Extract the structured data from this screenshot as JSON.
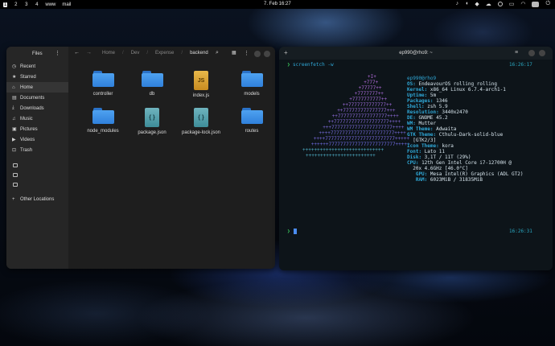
{
  "topbar": {
    "workspaces": [
      "1",
      "2",
      "3",
      "4",
      "www",
      "mail"
    ],
    "active_workspace": "1",
    "clock": "7. Feb  16:27",
    "tray_icons": [
      "bell-icon",
      "speaker-icon",
      "bird-icon",
      "cloud-icon",
      "clipboard-icon",
      "display-icon",
      "wifi-icon",
      "battery-icon",
      "power-icon"
    ]
  },
  "files": {
    "title": "Files",
    "sidebar": [
      {
        "icon": "clock-icon",
        "glyph": "◷",
        "label": "Recent"
      },
      {
        "icon": "star-icon",
        "glyph": "★",
        "label": "Starred"
      },
      {
        "icon": "home-icon",
        "glyph": "⌂",
        "label": "Home"
      },
      {
        "icon": "document-icon",
        "glyph": "▤",
        "label": "Documents"
      },
      {
        "icon": "download-icon",
        "glyph": "⤓",
        "label": "Downloads"
      },
      {
        "icon": "music-icon",
        "glyph": "♫",
        "label": "Music"
      },
      {
        "icon": "picture-icon",
        "glyph": "▣",
        "label": "Pictures"
      },
      {
        "icon": "video-icon",
        "glyph": "▶",
        "label": "Videos"
      },
      {
        "icon": "trash-icon",
        "glyph": "⊡",
        "label": "Trash"
      }
    ],
    "other_locations": {
      "glyph": "+",
      "label": "Other Locations"
    },
    "path": [
      "Home",
      "Dev",
      "Expense",
      "backend"
    ],
    "items": [
      {
        "name": "controller",
        "type": "folder"
      },
      {
        "name": "db",
        "type": "folder"
      },
      {
        "name": "index.js",
        "type": "js",
        "badge": "JS"
      },
      {
        "name": "models",
        "type": "folder"
      },
      {
        "name": "node_modules",
        "type": "folder"
      },
      {
        "name": "package.json",
        "type": "json",
        "badge": "{ }"
      },
      {
        "name": "package-lock.json",
        "type": "json",
        "badge": "{ }"
      },
      {
        "name": "routes",
        "type": "folder"
      }
    ]
  },
  "terminal": {
    "title": "ep990@rho9: ~",
    "prompt_symbol": "❯",
    "command": "screenfetch -w",
    "time1": "16:26:17",
    "time2": "16:26:31",
    "logo_lines": [
      "+I+",
      "+777+",
      "+77777++",
      "+7777777++",
      "+7777777777++",
      "++7777777777777++",
      "++777777777777777+++",
      "++77777777777777777++++",
      "++7777777777777777777++++",
      "+++777777777777777777777++++",
      "++++7777777777777777777777++++",
      "++++777777777777777777777777+++++",
      "++++++77777777777777777777777+++++",
      "++++++++++++++++++++++++++++",
      "++++++++++++++++++++++++"
    ],
    "info": [
      {
        "key": "",
        "value": "ep990@rho9"
      },
      {
        "key": "OS:",
        "value": " EndeavourOS rolling rolling"
      },
      {
        "key": "Kernel:",
        "value": " x86_64 Linux 6.7.4-arch1-1"
      },
      {
        "key": "Uptime:",
        "value": " 5m"
      },
      {
        "key": "Packages:",
        "value": " 1346"
      },
      {
        "key": "Shell:",
        "value": " zsh 5.9"
      },
      {
        "key": "Resolution:",
        "value": " 3440x2470"
      },
      {
        "key": "DE:",
        "value": " GNOME 45.2"
      },
      {
        "key": "WM:",
        "value": " Mutter"
      },
      {
        "key": "WM Theme:",
        "value": " Adwaita"
      },
      {
        "key": "GTK Theme:",
        "value": " Cthulu-Dark-solid-blue"
      },
      {
        "key": "",
        "value": "  [GTK2/3]"
      },
      {
        "key": "Icon Theme:",
        "value": " kora"
      },
      {
        "key": "Font:",
        "value": " Lato 11"
      },
      {
        "key": "Disk:",
        "value": " 3,1T / 11T (29%)"
      },
      {
        "key": "CPU:",
        "value": " 12th Gen Intel Core i7-12700H @"
      },
      {
        "key": "",
        "value": "  20x 4.6GHz [46.0°C]"
      },
      {
        "key": "   GPU:",
        "value": " Mesa Intel(R) Graphics (ADL GT2)"
      },
      {
        "key": "   RAM:",
        "value": " 6023MiB / 31835MiB"
      }
    ]
  }
}
